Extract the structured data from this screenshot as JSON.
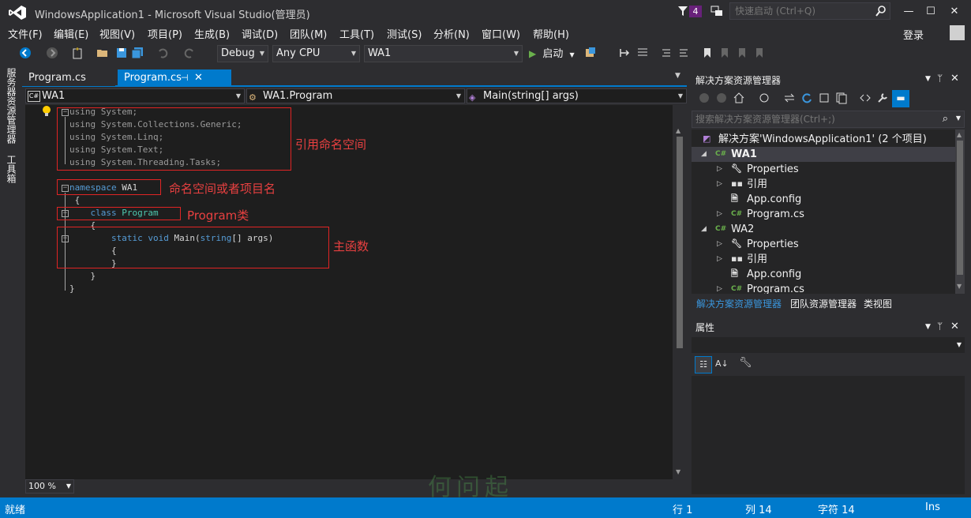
{
  "window": {
    "title": "WindowsApplication1 - Microsoft Visual Studio(管理员)",
    "notification_count": "4",
    "quick_launch_placeholder": "快速启动 (Ctrl+Q)",
    "login": "登录",
    "min": "—",
    "max": "☐",
    "close": "✕"
  },
  "menu": [
    "文件(F)",
    "编辑(E)",
    "视图(V)",
    "项目(P)",
    "生成(B)",
    "调试(D)",
    "团队(M)",
    "工具(T)",
    "测试(S)",
    "分析(N)",
    "窗口(W)",
    "帮助(H)"
  ],
  "toolbar": {
    "config": "Debug",
    "platform": "Any CPU",
    "startup_project": "WA1",
    "start_label": "启动"
  },
  "left_strip": [
    "服务器资源管理器",
    "工具箱"
  ],
  "editor": {
    "tabs": [
      {
        "label": "Program.cs",
        "active": false
      },
      {
        "label": "Program.cs",
        "active": true
      }
    ],
    "nav": {
      "project": "WA1",
      "type": "WA1.Program",
      "member": "Main(string[] args)"
    },
    "zoom": "100 %",
    "lines": [
      [
        {
          "t": "using",
          "c": "dim"
        },
        {
          "t": " System;",
          "c": "dim"
        }
      ],
      [
        {
          "t": "using",
          "c": "dim"
        },
        {
          "t": " System.Collections.Generic;",
          "c": "dim"
        }
      ],
      [
        {
          "t": "using",
          "c": "dim"
        },
        {
          "t": " System.Linq;",
          "c": "dim"
        }
      ],
      [
        {
          "t": "using",
          "c": "dim"
        },
        {
          "t": " System.Text;",
          "c": "dim"
        }
      ],
      [
        {
          "t": "using",
          "c": "dim"
        },
        {
          "t": " System.Threading.Tasks;",
          "c": "dim"
        }
      ],
      [],
      [
        {
          "t": "namespace",
          "c": "kw"
        },
        {
          "t": " WA1",
          "c": ""
        }
      ],
      [
        {
          "t": " {",
          "c": ""
        }
      ],
      [
        {
          "t": "    ",
          "c": ""
        },
        {
          "t": "class",
          "c": "kw"
        },
        {
          "t": " ",
          "c": ""
        },
        {
          "t": "Program",
          "c": "cls"
        }
      ],
      [
        {
          "t": "    {",
          "c": ""
        }
      ],
      [
        {
          "t": "        ",
          "c": ""
        },
        {
          "t": "static",
          "c": "kw"
        },
        {
          "t": " ",
          "c": ""
        },
        {
          "t": "void",
          "c": "kw"
        },
        {
          "t": " Main(",
          "c": ""
        },
        {
          "t": "string",
          "c": "kw"
        },
        {
          "t": "[] args)",
          "c": ""
        }
      ],
      [
        {
          "t": "        {",
          "c": ""
        }
      ],
      [
        {
          "t": "        }",
          "c": ""
        }
      ],
      [
        {
          "t": "    }",
          "c": ""
        }
      ],
      [
        {
          "t": "}",
          "c": ""
        }
      ]
    ],
    "annotations": {
      "using": "引用命名空间",
      "namespace": "命名空间或者项目名",
      "class": "Program类",
      "main": "主函数"
    }
  },
  "solution_explorer": {
    "title": "解决方案资源管理器",
    "search_placeholder": "搜索解决方案资源管理器(Ctrl+;)",
    "items": [
      {
        "label": "解决方案'WindowsApplication1' (2 个项目)",
        "icon": "solution-icon",
        "level": 0,
        "expander": ""
      },
      {
        "label": "WA1",
        "icon": "csharp-project-icon",
        "level": 1,
        "expander": "▲",
        "bold": true
      },
      {
        "label": "Properties",
        "icon": "wrench-icon",
        "level": 2,
        "expander": "▷"
      },
      {
        "label": "引用",
        "icon": "references-icon",
        "level": 2,
        "expander": "▷"
      },
      {
        "label": "App.config",
        "icon": "config-file-icon",
        "level": 2,
        "expander": ""
      },
      {
        "label": "Program.cs",
        "icon": "csharp-file-icon",
        "level": 2,
        "expander": "▷"
      },
      {
        "label": "WA2",
        "icon": "csharp-project-icon",
        "level": 1,
        "expander": "▲"
      },
      {
        "label": "Properties",
        "icon": "wrench-icon",
        "level": 2,
        "expander": "▷"
      },
      {
        "label": "引用",
        "icon": "references-icon",
        "level": 2,
        "expander": "▷"
      },
      {
        "label": "App.config",
        "icon": "config-file-icon",
        "level": 2,
        "expander": ""
      },
      {
        "label": "Program.cs",
        "icon": "csharp-file-icon",
        "level": 2,
        "expander": "▷"
      }
    ],
    "tabs": [
      "解决方案资源管理器",
      "团队资源管理器",
      "类视图"
    ]
  },
  "properties": {
    "title": "属性"
  },
  "status": {
    "ready": "就绪",
    "line": "行 1",
    "col": "列 14",
    "char": "字符 14",
    "mode": "Ins"
  },
  "watermark": "何问起",
  "colors": {
    "accent": "#007acc",
    "annotation": "#e02424",
    "keyword": "#569cd6",
    "class": "#4ec9b0"
  }
}
